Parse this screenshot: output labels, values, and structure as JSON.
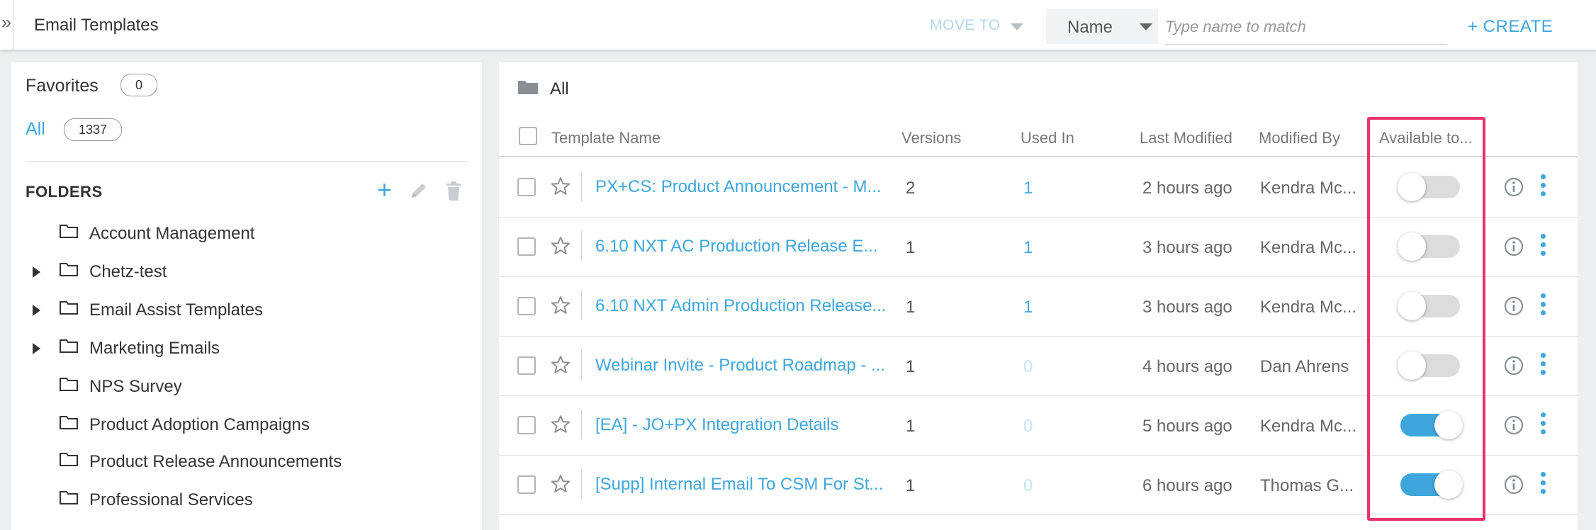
{
  "header": {
    "title": "Email Templates",
    "move_to_label": "MOVE TO",
    "filter_field": "Name",
    "filter_placeholder": "Type name to match",
    "create_label": "+ CREATE"
  },
  "sidebar": {
    "favorites_label": "Favorites",
    "favorites_count": "0",
    "all_label": "All",
    "all_count": "1337",
    "folders_label": "FOLDERS",
    "folders": [
      {
        "name": "Account Management",
        "expandable": false
      },
      {
        "name": "Chetz-test",
        "expandable": true
      },
      {
        "name": "Email Assist Templates",
        "expandable": true
      },
      {
        "name": "Marketing Emails",
        "expandable": true
      },
      {
        "name": "NPS Survey",
        "expandable": false
      },
      {
        "name": "Product Adoption Campaigns",
        "expandable": false
      },
      {
        "name": "Product Release Announcements",
        "expandable": false
      },
      {
        "name": "Professional Services",
        "expandable": false
      }
    ]
  },
  "main": {
    "breadcrumb": "All",
    "columns": {
      "template_name": "Template Name",
      "versions": "Versions",
      "used_in": "Used In",
      "last_modified": "Last Modified",
      "modified_by": "Modified By",
      "available_to": "Available to..."
    },
    "rows": [
      {
        "name": "PX+CS: Product Announcement - M...",
        "versions": "2",
        "used_in": "1",
        "last_modified": "2 hours ago",
        "modified_by": "Kendra Mc...",
        "available": false
      },
      {
        "name": "6.10 NXT AC Production Release E...",
        "versions": "1",
        "used_in": "1",
        "last_modified": "3 hours ago",
        "modified_by": "Kendra Mc...",
        "available": false
      },
      {
        "name": "6.10 NXT Admin Production Release...",
        "versions": "1",
        "used_in": "1",
        "last_modified": "3 hours ago",
        "modified_by": "Kendra Mc...",
        "available": false
      },
      {
        "name": "Webinar Invite - Product Roadmap - ...",
        "versions": "1",
        "used_in": "0",
        "last_modified": "4 hours ago",
        "modified_by": "Dan Ahrens",
        "available": false
      },
      {
        "name": "[EA] - JO+PX Integration Details",
        "versions": "1",
        "used_in": "0",
        "last_modified": "5 hours ago",
        "modified_by": "Kendra Mc...",
        "available": true
      },
      {
        "name": "[Supp] Internal Email To CSM For St...",
        "versions": "1",
        "used_in": "0",
        "last_modified": "6 hours ago",
        "modified_by": "Thomas G...",
        "available": true
      }
    ]
  },
  "colors": {
    "accent": "#3ea6dc",
    "highlight": "#e8336b",
    "toggle_off": "#dcdcdc"
  }
}
